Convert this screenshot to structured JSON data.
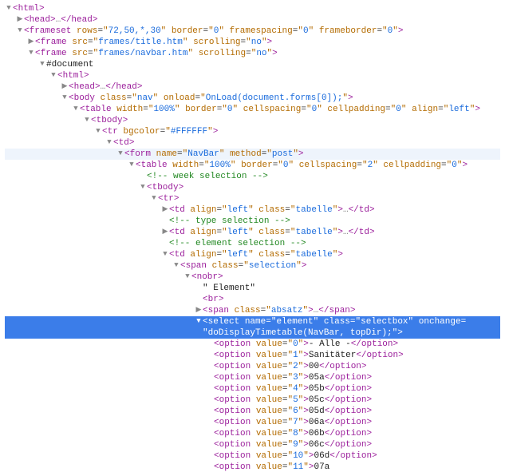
{
  "lines": [
    {
      "indent": 0,
      "arrow": "down",
      "type": "open",
      "tag": "html",
      "attrs": []
    },
    {
      "indent": 1,
      "arrow": "right",
      "type": "openclose",
      "tag": "head",
      "attrs": []
    },
    {
      "indent": 1,
      "arrow": "down",
      "type": "open",
      "tag": "frameset",
      "attrs": [
        [
          "rows",
          "72,50,*,30"
        ],
        [
          "border",
          "0"
        ],
        [
          "framespacing",
          "0"
        ],
        [
          "frameborder",
          "0"
        ]
      ]
    },
    {
      "indent": 2,
      "arrow": "right",
      "type": "self",
      "tag": "frame",
      "attrs": [
        [
          "src",
          "frames/title.htm"
        ],
        [
          "scrolling",
          "no"
        ]
      ]
    },
    {
      "indent": 2,
      "arrow": "down",
      "type": "self",
      "tag": "frame",
      "attrs": [
        [
          "src",
          "frames/navbar.htm"
        ],
        [
          "scrolling",
          "no"
        ]
      ]
    },
    {
      "indent": 3,
      "arrow": "down",
      "type": "pseudo",
      "text": "#document"
    },
    {
      "indent": 4,
      "arrow": "down",
      "type": "open",
      "tag": "html",
      "attrs": []
    },
    {
      "indent": 5,
      "arrow": "right",
      "type": "openclose",
      "tag": "head",
      "attrs": []
    },
    {
      "indent": 5,
      "arrow": "down",
      "type": "open",
      "tag": "body",
      "attrs": [
        [
          "class",
          "nav"
        ],
        [
          "onload",
          "OnLoad(document.forms[0]);"
        ]
      ]
    },
    {
      "indent": 6,
      "arrow": "down",
      "type": "open",
      "tag": "table",
      "attrs": [
        [
          "width",
          "100%"
        ],
        [
          "border",
          "0"
        ],
        [
          "cellspacing",
          "0"
        ],
        [
          "cellpadding",
          "0"
        ],
        [
          "align",
          "left"
        ]
      ]
    },
    {
      "indent": 7,
      "arrow": "down",
      "type": "open",
      "tag": "tbody",
      "attrs": []
    },
    {
      "indent": 8,
      "arrow": "down",
      "type": "open",
      "tag": "tr",
      "attrs": [
        [
          "bgcolor",
          "#FFFFFF"
        ]
      ]
    },
    {
      "indent": 9,
      "arrow": "down",
      "type": "open",
      "tag": "td",
      "attrs": []
    },
    {
      "indent": 10,
      "arrow": "down",
      "type": "open",
      "tag": "form",
      "attrs": [
        [
          "name",
          "NavBar"
        ],
        [
          "method",
          "post"
        ]
      ],
      "hover": true
    },
    {
      "indent": 11,
      "arrow": "down",
      "type": "open",
      "tag": "table",
      "attrs": [
        [
          "width",
          "100%"
        ],
        [
          "border",
          "0"
        ],
        [
          "cellspacing",
          "2"
        ],
        [
          "cellpadding",
          "0"
        ]
      ]
    },
    {
      "indent": 12,
      "arrow": "",
      "type": "comment",
      "text": "<!-- week selection -->"
    },
    {
      "indent": 12,
      "arrow": "down",
      "type": "open",
      "tag": "tbody",
      "attrs": []
    },
    {
      "indent": 13,
      "arrow": "down",
      "type": "open",
      "tag": "tr",
      "attrs": []
    },
    {
      "indent": 14,
      "arrow": "right",
      "type": "openclose",
      "tag": "td",
      "attrs": [
        [
          "align",
          "left"
        ],
        [
          "class",
          "tabelle"
        ]
      ]
    },
    {
      "indent": 14,
      "arrow": "",
      "type": "comment",
      "text": "<!-- type selection -->"
    },
    {
      "indent": 14,
      "arrow": "right",
      "type": "openclose",
      "tag": "td",
      "attrs": [
        [
          "align",
          "left"
        ],
        [
          "class",
          "tabelle"
        ]
      ]
    },
    {
      "indent": 14,
      "arrow": "",
      "type": "comment",
      "text": "<!-- element selection -->"
    },
    {
      "indent": 14,
      "arrow": "down",
      "type": "open",
      "tag": "td",
      "attrs": [
        [
          "align",
          "left"
        ],
        [
          "class",
          "tabelle"
        ]
      ]
    },
    {
      "indent": 15,
      "arrow": "down",
      "type": "open",
      "tag": "span",
      "attrs": [
        [
          "class",
          "selection"
        ]
      ]
    },
    {
      "indent": 16,
      "arrow": "down",
      "type": "open",
      "tag": "nobr",
      "attrs": []
    },
    {
      "indent": 17,
      "arrow": "",
      "type": "text",
      "text": "\" Element\""
    },
    {
      "indent": 17,
      "arrow": "",
      "type": "self",
      "tag": "br",
      "attrs": []
    },
    {
      "indent": 17,
      "arrow": "right",
      "type": "openclose",
      "tag": "span",
      "attrs": [
        [
          "class",
          "absatz"
        ]
      ]
    },
    {
      "indent": 17,
      "arrow": "down",
      "type": "open-multiline",
      "tag": "select",
      "selected": true,
      "attrs": [
        [
          "name",
          "element"
        ],
        [
          "class",
          "selectbox"
        ],
        [
          "onchange",
          "doDisplayTimetable(NavBar, topDir);"
        ]
      ]
    },
    {
      "indent": 18,
      "arrow": "",
      "type": "option",
      "attrs": [
        [
          "value",
          "0"
        ]
      ],
      "inner": "- Alle -"
    },
    {
      "indent": 18,
      "arrow": "",
      "type": "option",
      "attrs": [
        [
          "value",
          "1"
        ]
      ],
      "inner": "Sanitäter"
    },
    {
      "indent": 18,
      "arrow": "",
      "type": "option",
      "attrs": [
        [
          "value",
          "2"
        ]
      ],
      "inner": "00"
    },
    {
      "indent": 18,
      "arrow": "",
      "type": "option",
      "attrs": [
        [
          "value",
          "3"
        ]
      ],
      "inner": "05a"
    },
    {
      "indent": 18,
      "arrow": "",
      "type": "option",
      "attrs": [
        [
          "value",
          "4"
        ]
      ],
      "inner": "05b"
    },
    {
      "indent": 18,
      "arrow": "",
      "type": "option",
      "attrs": [
        [
          "value",
          "5"
        ]
      ],
      "inner": "05c"
    },
    {
      "indent": 18,
      "arrow": "",
      "type": "option",
      "attrs": [
        [
          "value",
          "6"
        ]
      ],
      "inner": "05d"
    },
    {
      "indent": 18,
      "arrow": "",
      "type": "option",
      "attrs": [
        [
          "value",
          "7"
        ]
      ],
      "inner": "06a"
    },
    {
      "indent": 18,
      "arrow": "",
      "type": "option",
      "attrs": [
        [
          "value",
          "8"
        ]
      ],
      "inner": "06b"
    },
    {
      "indent": 18,
      "arrow": "",
      "type": "option",
      "attrs": [
        [
          "value",
          "9"
        ]
      ],
      "inner": "06c"
    },
    {
      "indent": 18,
      "arrow": "",
      "type": "option",
      "attrs": [
        [
          "value",
          "10"
        ]
      ],
      "inner": "06d"
    },
    {
      "indent": 18,
      "arrow": "",
      "type": "option",
      "attrs": [
        [
          "value",
          "11"
        ]
      ],
      "inner": "07a",
      "cut": true
    }
  ],
  "indentUnit": 14
}
